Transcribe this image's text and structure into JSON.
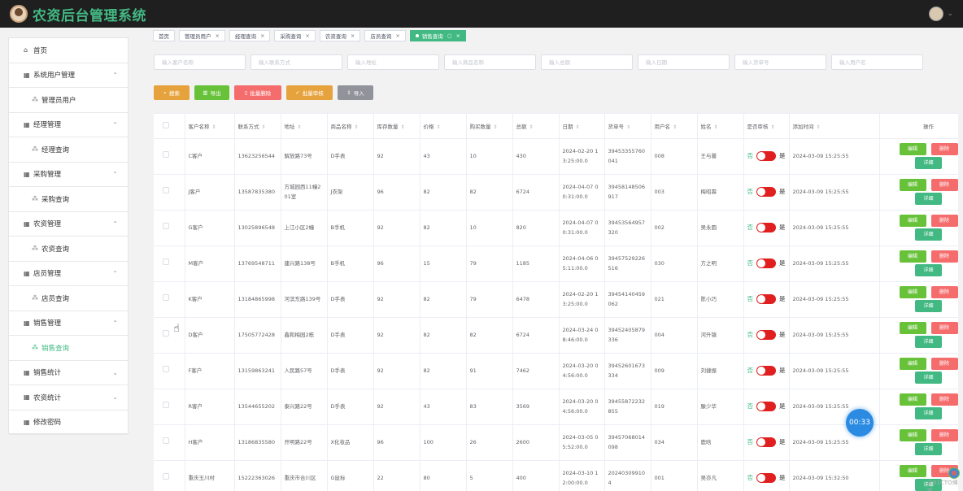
{
  "app": {
    "title": "农资后台管理系统"
  },
  "sidebar": {
    "items": [
      {
        "label": "首页",
        "icon": "home-icon",
        "type": "top"
      },
      {
        "label": "系统用户管理",
        "icon": "grid-icon",
        "type": "group",
        "expanded": true
      },
      {
        "label": "管理员用户",
        "icon": "apps-icon",
        "type": "sub"
      },
      {
        "label": "经理管理",
        "icon": "grid-icon",
        "type": "group",
        "expanded": true
      },
      {
        "label": "经理查询",
        "icon": "apps-icon",
        "type": "sub"
      },
      {
        "label": "采购管理",
        "icon": "grid-icon",
        "type": "group",
        "expanded": true
      },
      {
        "label": "采购查询",
        "icon": "apps-icon",
        "type": "sub"
      },
      {
        "label": "农资管理",
        "icon": "grid-icon",
        "type": "group",
        "expanded": true
      },
      {
        "label": "农资查询",
        "icon": "apps-icon",
        "type": "sub"
      },
      {
        "label": "店员管理",
        "icon": "grid-icon",
        "type": "group",
        "expanded": true
      },
      {
        "label": "店员查询",
        "icon": "apps-icon",
        "type": "sub"
      },
      {
        "label": "销售管理",
        "icon": "grid-icon",
        "type": "group",
        "expanded": true
      },
      {
        "label": "销售查询",
        "icon": "apps-icon",
        "type": "sub",
        "active": true
      },
      {
        "label": "销售统计",
        "icon": "grid-icon",
        "type": "group",
        "expanded": false
      },
      {
        "label": "农资统计",
        "icon": "grid-icon",
        "type": "group",
        "expanded": false
      },
      {
        "label": "修改密码",
        "icon": "grid-icon",
        "type": "top"
      }
    ]
  },
  "tabs": [
    {
      "label": "首页",
      "closable": false
    },
    {
      "label": "管理员用户",
      "closable": true
    },
    {
      "label": "经理查询",
      "closable": true
    },
    {
      "label": "采购查询",
      "closable": true
    },
    {
      "label": "农资查询",
      "closable": true
    },
    {
      "label": "店员查询",
      "closable": true
    },
    {
      "label": "销售查询",
      "closable": true,
      "active": true
    }
  ],
  "search": {
    "placeholders": [
      "输入客户名称",
      "输入联系方式",
      "输入地址",
      "输入商品名称",
      "输入总额",
      "输入日期",
      "输入货单号",
      "输入用户名"
    ]
  },
  "actions": {
    "search": "搜索",
    "export": "导出",
    "batch_delete": "批量删除",
    "batch_audit": "批量审核",
    "import": "导入"
  },
  "table": {
    "columns": [
      "客户名称",
      "联系方式",
      "地址",
      "商品名称",
      "库存数量",
      "价格",
      "购买数量",
      "总额",
      "日期",
      "货单号",
      "用户名",
      "姓名",
      "是否审核",
      "添加时间",
      "操作"
    ],
    "switch_off_label": "否",
    "switch_on_label": "是",
    "op_edit": "编辑",
    "op_delete": "删除",
    "op_detail": "详细",
    "rows": [
      {
        "customer": "C客户",
        "phone": "13623256544",
        "address": "解放路73号",
        "product": "D手表",
        "stock": "92",
        "price": "43",
        "qty": "10",
        "total": "430",
        "date": "2024-02-20 13:25:00.0",
        "order_no": "39453355760041",
        "username": "008",
        "name": "王与馨",
        "created": "2024-03-09 15:25:55"
      },
      {
        "customer": "J客户",
        "phone": "13587835380",
        "address": "方城园西11幢201室",
        "product": "J衣架",
        "stock": "96",
        "price": "82",
        "qty": "82",
        "total": "6724",
        "date": "2024-04-07 00:31:00.0",
        "order_no": "39458148506917",
        "username": "003",
        "name": "梅昭霖",
        "created": "2024-03-09 15:25:55"
      },
      {
        "customer": "G客户",
        "phone": "13025896548",
        "address": "上江小区2幢",
        "product": "B手机",
        "stock": "92",
        "price": "82",
        "qty": "10",
        "total": "820",
        "date": "2024-04-07 00:31:00.0",
        "order_no": "39453564957320",
        "username": "002",
        "name": "吴永圆",
        "created": "2024-03-09 15:25:55"
      },
      {
        "customer": "M客户",
        "phone": "13769548711",
        "address": "建兴路138号",
        "product": "B手机",
        "stock": "96",
        "price": "15",
        "qty": "79",
        "total": "1185",
        "date": "2024-04-06 05:11:00.0",
        "order_no": "39457529226516",
        "username": "030",
        "name": "方之明",
        "created": "2024-03-09 15:25:55"
      },
      {
        "customer": "K客户",
        "phone": "13184865998",
        "address": "河滨东路139号",
        "product": "D手表",
        "stock": "92",
        "price": "82",
        "qty": "79",
        "total": "6478",
        "date": "2024-02-20 13:25:00.0",
        "order_no": "39454140459062",
        "username": "021",
        "name": "陈小巧",
        "created": "2024-03-09 15:25:55"
      },
      {
        "customer": "D客户",
        "phone": "17505772428",
        "address": "鑫和梅园2栋",
        "product": "D手表",
        "stock": "92",
        "price": "82",
        "qty": "82",
        "total": "6724",
        "date": "2024-03-24 08:46:00.0",
        "order_no": "39452405879336",
        "username": "004",
        "name": "河升镇",
        "created": "2024-03-09 15:25:55"
      },
      {
        "customer": "F客户",
        "phone": "13159863241",
        "address": "人民路57号",
        "product": "D手表",
        "stock": "92",
        "price": "82",
        "qty": "91",
        "total": "7462",
        "date": "2024-03-20 04:56:00.0",
        "order_no": "39452601673334",
        "username": "009",
        "name": "刘捷振",
        "created": "2024-03-09 15:25:55"
      },
      {
        "customer": "R客户",
        "phone": "13544655202",
        "address": "泰兴路22号",
        "product": "D手表",
        "stock": "92",
        "price": "43",
        "qty": "83",
        "total": "3569",
        "date": "2024-03-20 04:56:00.0",
        "order_no": "39455872232855",
        "username": "019",
        "name": "滕少华",
        "created": "2024-03-09 15:25:55"
      },
      {
        "customer": "H客户",
        "phone": "13186835580",
        "address": "开明路22号",
        "product": "X化妆品",
        "stock": "96",
        "price": "100",
        "qty": "26",
        "total": "2600",
        "date": "2024-03-05 05:52:00.0",
        "order_no": "39457068014098",
        "username": "034",
        "name": "鹿晗",
        "created": "2024-03-09 15:25:55"
      },
      {
        "customer": "重庆玉川村",
        "phone": "15222363026",
        "address": "重庆市合川区",
        "product": "G鼠标",
        "stock": "22",
        "price": "80",
        "qty": "5",
        "total": "400",
        "date": "2024-03-10 12:00:00.0",
        "order_no": "202403099104",
        "username": "001",
        "name": "吴亦凡",
        "created": "2024-03-09 15:32:50"
      }
    ]
  },
  "floating": {
    "timer": "00:33",
    "watermark": "@51CTO博客"
  },
  "colors": {
    "brand": "#42b983",
    "header_bg": "#1f1f1f",
    "warning": "#e6a23c",
    "success": "#67c23a",
    "danger": "#f56c6c",
    "info": "#909399"
  }
}
